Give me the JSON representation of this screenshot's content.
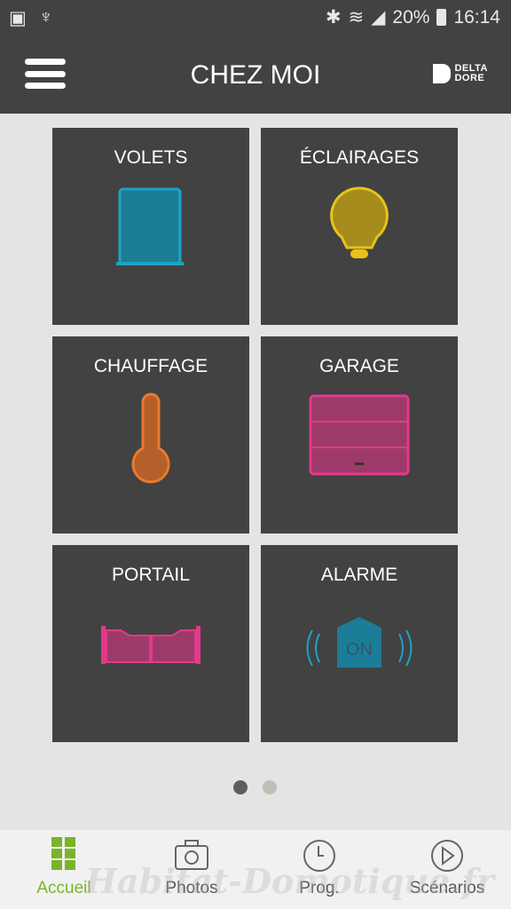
{
  "status_bar": {
    "battery": "20%",
    "time": "16:14",
    "icons": [
      "image-icon",
      "usb-debug-icon",
      "bluetooth-icon",
      "wifi-icon",
      "signal-icon",
      "battery-icon"
    ]
  },
  "header": {
    "title": "CHEZ MOI",
    "logo": "DELTA DORE",
    "logo_line1": "DELTA",
    "logo_line2": "DORE"
  },
  "tiles": [
    {
      "label": "VOLETS",
      "icon": "shutter-icon",
      "color": "#1fa3c4"
    },
    {
      "label": "ÉCLAIRAGES",
      "icon": "bulb-icon",
      "color": "#e8c31a"
    },
    {
      "label": "CHAUFFAGE",
      "icon": "thermometer-icon",
      "color": "#e87a2b"
    },
    {
      "label": "GARAGE",
      "icon": "garage-door-icon",
      "color": "#e23a8a"
    },
    {
      "label": "PORTAIL",
      "icon": "gate-icon",
      "color": "#e23a8a"
    },
    {
      "label": "ALARME",
      "icon": "alarm-icon",
      "color": "#1fa3c4",
      "badge": "ON"
    }
  ],
  "pager": {
    "pages": 2,
    "current": 1
  },
  "nav": {
    "items": [
      {
        "label": "Accueil",
        "icon": "grid-icon",
        "active": true
      },
      {
        "label": "Photos",
        "icon": "camera-icon"
      },
      {
        "label": "Prog.",
        "icon": "clock-icon"
      },
      {
        "label": "Scénarios",
        "icon": "play-icon"
      }
    ],
    "active_color": "#7cb32a"
  },
  "watermark": "Habitat-Domotique.fr"
}
